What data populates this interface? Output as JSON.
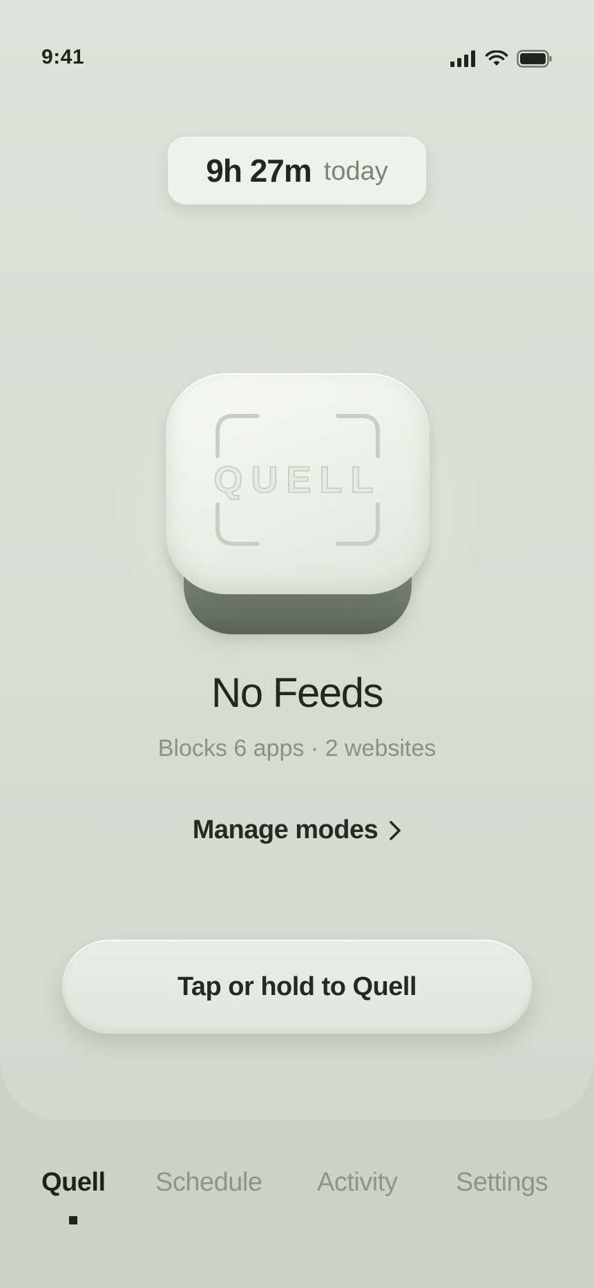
{
  "status_bar": {
    "time": "9:41",
    "icons": [
      "cellular-signal-icon",
      "wifi-icon",
      "battery-icon"
    ]
  },
  "usage": {
    "duration": "9h 27m",
    "period": "today"
  },
  "device": {
    "logo_text": "QUELL"
  },
  "mode": {
    "title": "No Feeds",
    "subtitle": "Blocks 6 apps · 2 websites",
    "manage_label": "Manage modes"
  },
  "action": {
    "label": "Tap or hold to Quell"
  },
  "tabs": [
    {
      "label": "Quell",
      "active": true
    },
    {
      "label": "Schedule",
      "active": false
    },
    {
      "label": "Activity",
      "active": false
    },
    {
      "label": "Settings",
      "active": false
    }
  ],
  "colors": {
    "background": "#dfe2dc",
    "text_primary": "#232722",
    "text_secondary": "#8a9088",
    "device_shadow": "#5a6358"
  }
}
